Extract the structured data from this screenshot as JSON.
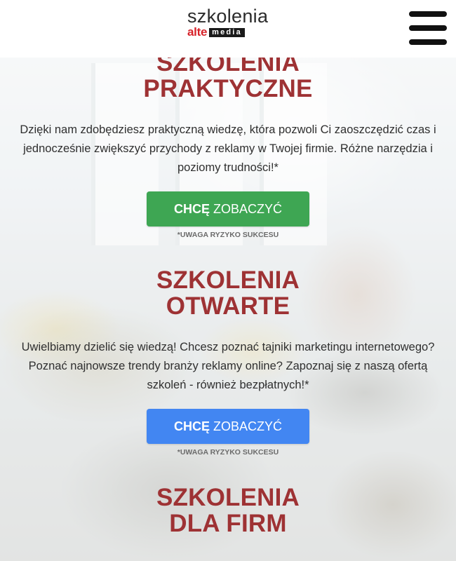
{
  "header": {
    "logo_top": "szkolenia",
    "logo_alte": "alte",
    "logo_media": "media",
    "menu_icon": "hamburger-menu-icon"
  },
  "sections": [
    {
      "title_line1": "SZKOLENIA",
      "title_line2": "PRAKTYCZNE",
      "description": "Dzięki nam zdobędziesz praktyczną wiedzę, która pozwoli Ci zaoszczędzić czas i jednocześnie zwiększyć przychody z reklamy w Twojej firmie. Różne narzędzia i poziomy trudności!*",
      "cta_bold": "CHCĘ",
      "cta_light": "ZOBACZYĆ",
      "cta_color": "#3ea653",
      "note": "*UWAGA RYZYKO SUKCESU"
    },
    {
      "title_line1": "SZKOLENIA",
      "title_line2": "OTWARTE",
      "description": "Uwielbiamy dzielić się wiedzą! Chcesz poznać tajniki marketingu internetowego? Poznać najnowsze trendy branży reklamy online? Zapoznaj się z naszą ofertą szkoleń - również bezpłatnych!*",
      "cta_bold": "CHCĘ",
      "cta_light": "ZOBACZYĆ",
      "cta_color": "#4286f2",
      "note": "*UWAGA RYZYKO SUKCESU"
    },
    {
      "title_line1": "SZKOLENIA",
      "title_line2": "DLA FIRM"
    }
  ],
  "colors": {
    "title": "#9e3234",
    "logo_accent": "#d7232a"
  }
}
